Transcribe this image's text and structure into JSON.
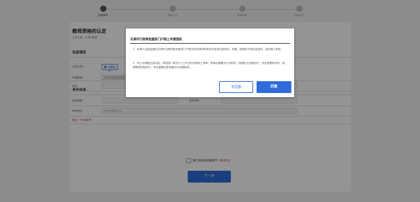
{
  "stepper": {
    "steps": [
      "信息填写",
      "资料上传",
      "资格审核",
      "领取证书"
    ]
  },
  "main": {
    "page_title": "教师资格的认定",
    "breadcrumb": "当前位置：天津市教委"
  },
  "section_basic": {
    "header": "信息填写",
    "apply_type_label": "认定方式*",
    "apply_type_value": "在职在岗",
    "apply_org_label": "申请机构*",
    "apply_org_value": "天津市河西区教育局"
  },
  "section_personal": {
    "header": "身份信息",
    "fields": {
      "name_label": "姓名",
      "id_type_label": "证件类型",
      "id_no_label": "证件号码",
      "contact_label": "联系地址",
      "contact_value": "天津市河西区XXX",
      "phone_label": "手机号码",
      "phone_value": "138****8888",
      "phone_error": "请输入11位正确手机号",
      "email_label": "电子邮箱",
      "email_value": "请输入电子邮箱",
      "required_note": "备注：*为必填项"
    }
  },
  "footer": {
    "agree_text": "我已阅读并同意遵守",
    "agree_link": "《承诺书》",
    "next_button": "下一步"
  },
  "modal": {
    "title": "天津市行政审批服务门户网上申请须知",
    "paragraph_1": "1、申请人应保证通过天津市互联网政务服务门户提交的申请材料和有关信息内容真实、完整，因提供不真实信息的，由申请人承担。",
    "paragraph_2": "2、网上申请提交成功后，审批部门将在5个工作日内完成网上预审。预审合格需补正材料的，按照补正流程进行，符合受理条件的，按照受理流程进行，有关重要信息将通过手机通知您。",
    "disagree_button": "不同意",
    "agree_button": "同意"
  },
  "colors": {
    "accent": "#2f6bd9",
    "error": "#d43030"
  }
}
